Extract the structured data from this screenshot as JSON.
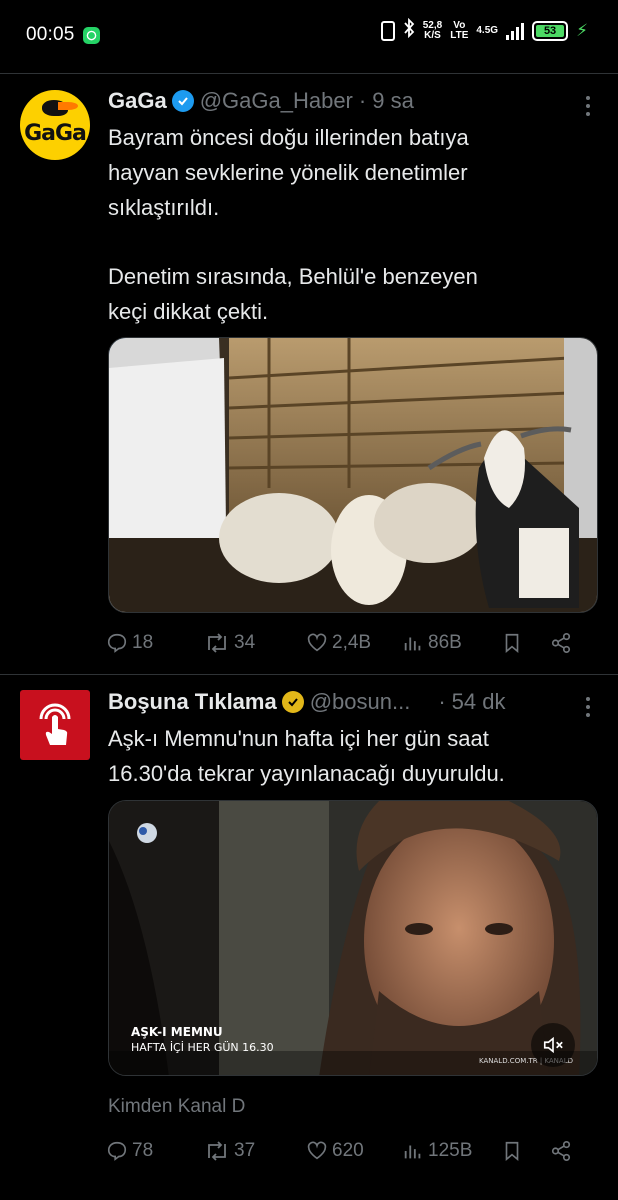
{
  "status_bar": {
    "time": "00:05",
    "net_speed_value": "52,8",
    "net_speed_unit": "K/S",
    "vo_top": "Vo",
    "vo_bottom": "LTE",
    "network": "4.5G",
    "battery": "53"
  },
  "tweets": [
    {
      "display_name": "GaGa",
      "handle": "@GaGa_Haber",
      "separator": "·",
      "time": "9 sa",
      "text_lines": [
        "Bayram öncesi doğu illerinden batıya",
        "hayvan sevklerine yönelik denetimler",
        "sıklaştırıldı.",
        "Denetim sırasında, Behlül'e benzeyen",
        "keçi dikkat çekti."
      ],
      "replies": "18",
      "reposts": "34",
      "likes": "2,4B",
      "views": "86B"
    },
    {
      "display_name": "Boşuna Tıklama",
      "handle": "@bosun...",
      "separator": "·",
      "time": "54 dk",
      "text_lines": [
        "Aşk-ı Memnu'nun hafta içi her gün saat",
        "16.30'da tekrar yayınlanacağı duyuruldu."
      ],
      "video_title": "AŞK-I MEMNU",
      "video_subtitle": "HAFTA İÇİ HER GÜN 16.30",
      "video_footer": "KANALD.COM.TR | KANALD",
      "source": "Kimden Kanal D",
      "replies": "78",
      "reposts": "37",
      "likes": "620",
      "views": "125B"
    }
  ],
  "colors": {
    "background": "#000000",
    "text": "#e7e9ea",
    "muted": "#71767b",
    "verified_blue": "#1d9bf0",
    "verified_gold": "#e2b719",
    "bosuna_red": "#c8101e",
    "gaga_yellow": "#fdd000"
  }
}
